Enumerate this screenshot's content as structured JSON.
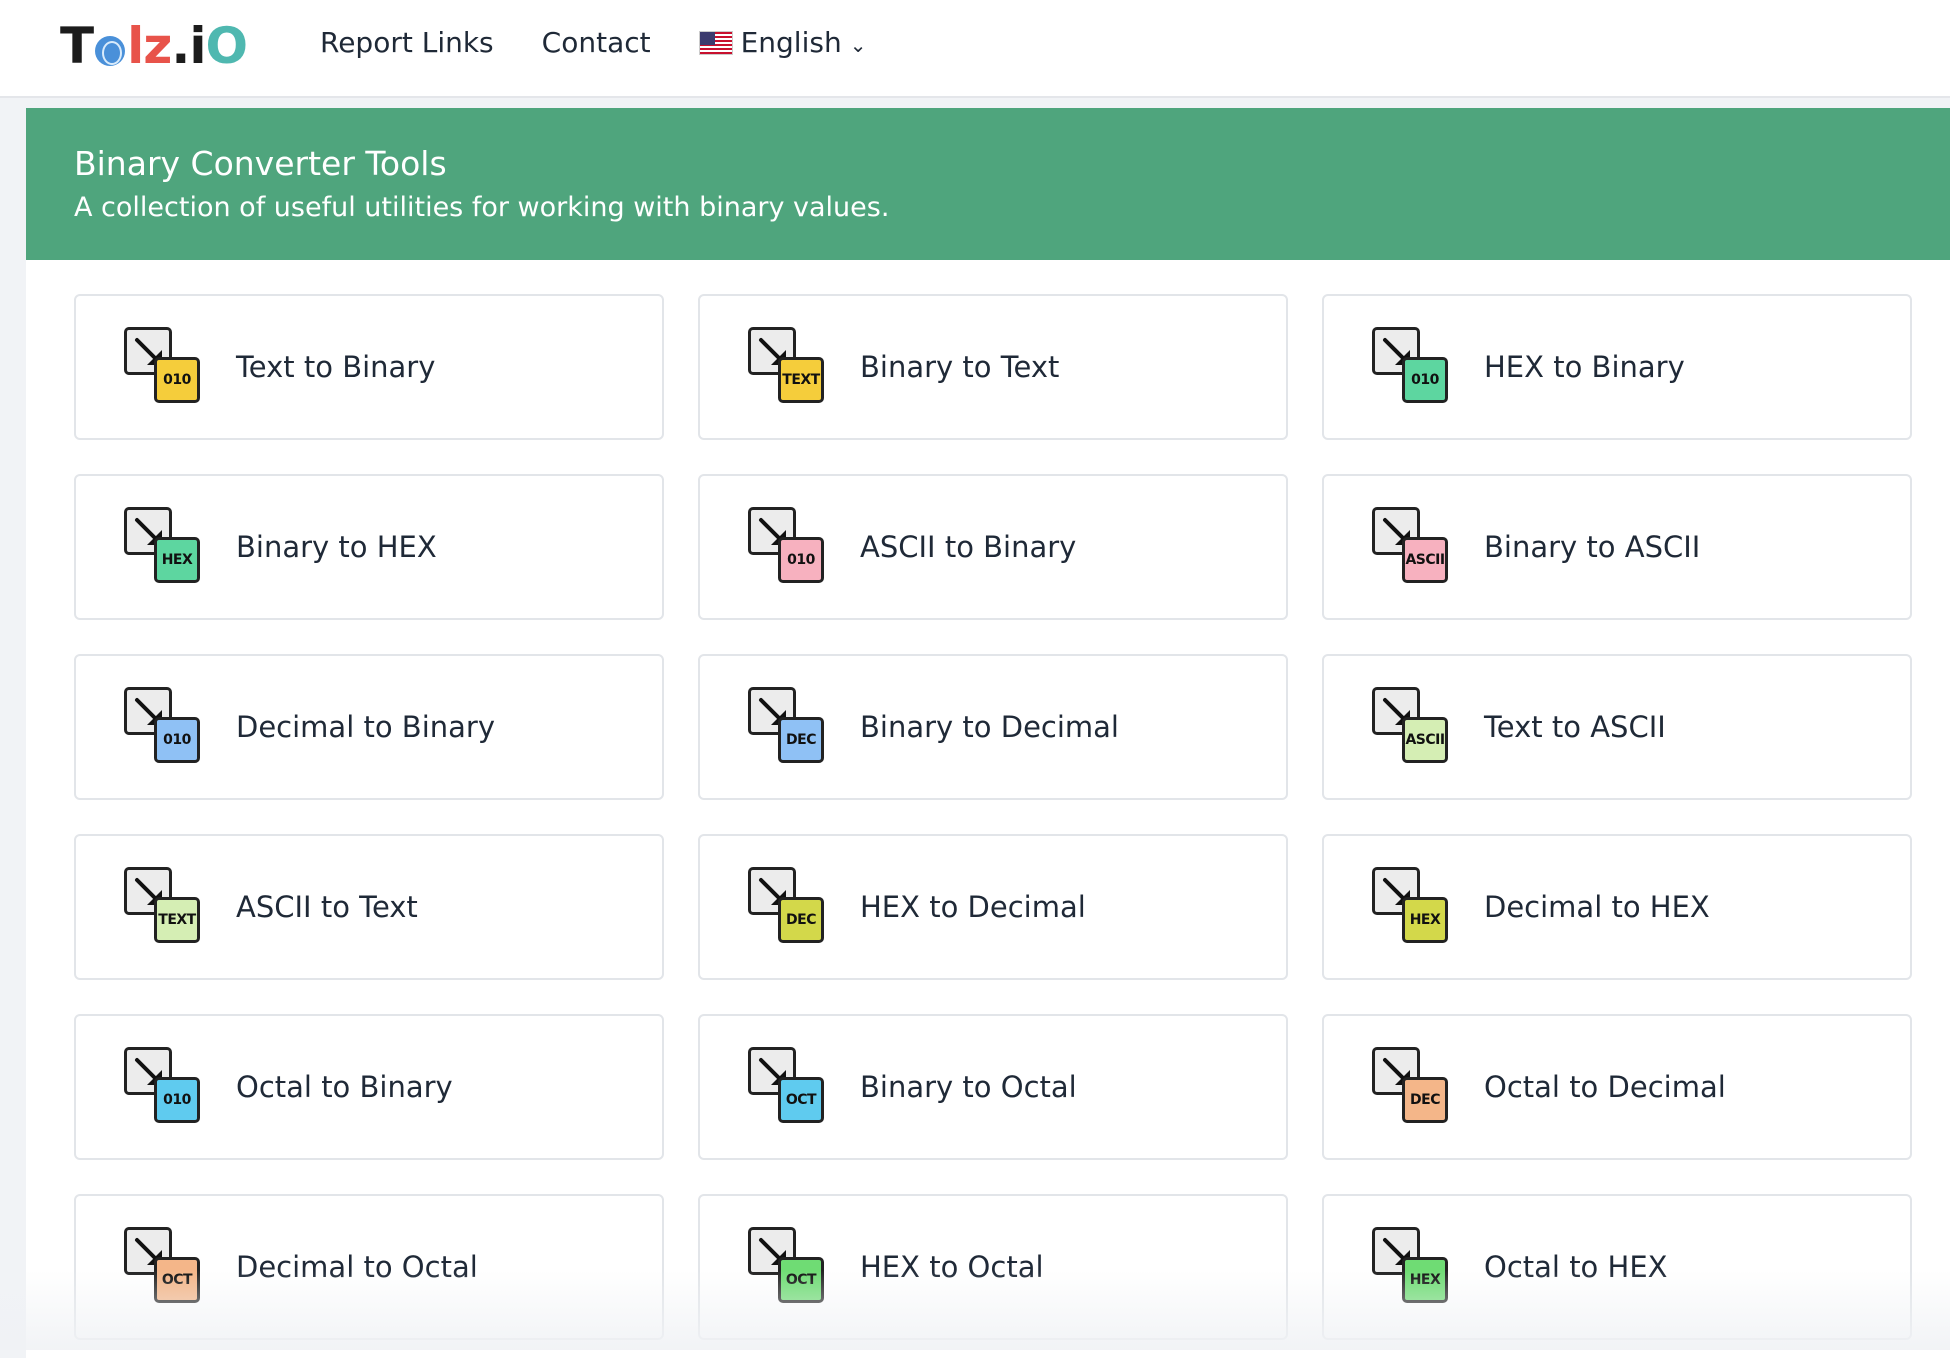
{
  "nav": {
    "logo": {
      "part1": "T",
      "part2": "lz",
      "part3": ".i",
      "part4": "O"
    },
    "links": [
      "Report Links",
      "Contact"
    ],
    "language": "English",
    "colors": {
      "logo_dark": "#1c1c1c",
      "logo_red": "#e8534a",
      "logo_teal": "#4fb8b0"
    }
  },
  "banner": {
    "title": "Binary Converter Tools",
    "subtitle": "A collection of useful utilities for working with binary values.",
    "color": "#4fa57d"
  },
  "tools": [
    {
      "label": "Text to Binary",
      "badge": "010",
      "color": "#f5cd3b"
    },
    {
      "label": "Binary to Text",
      "badge": "TEXT",
      "color": "#f5cd3b"
    },
    {
      "label": "HEX to Binary",
      "badge": "010",
      "color": "#5dd6a0"
    },
    {
      "label": "Binary to HEX",
      "badge": "HEX",
      "color": "#5dd6a0"
    },
    {
      "label": "ASCII to Binary",
      "badge": "010",
      "color": "#f7b1bf"
    },
    {
      "label": "Binary to ASCII",
      "badge": "ASCII",
      "color": "#f7b1bf"
    },
    {
      "label": "Decimal to Binary",
      "badge": "010",
      "color": "#8fc1f5"
    },
    {
      "label": "Binary to Decimal",
      "badge": "DEC",
      "color": "#8fc1f5"
    },
    {
      "label": "Text to ASCII",
      "badge": "ASCII",
      "color": "#d5eeb4"
    },
    {
      "label": "ASCII to Text",
      "badge": "TEXT",
      "color": "#d5eeb4"
    },
    {
      "label": "HEX to Decimal",
      "badge": "DEC",
      "color": "#d3d84a"
    },
    {
      "label": "Decimal to HEX",
      "badge": "HEX",
      "color": "#d3d84a"
    },
    {
      "label": "Octal to Binary",
      "badge": "010",
      "color": "#5fcbef"
    },
    {
      "label": "Binary to Octal",
      "badge": "OCT",
      "color": "#5fcbef"
    },
    {
      "label": "Octal to Decimal",
      "badge": "DEC",
      "color": "#f4b689"
    },
    {
      "label": "Decimal to Octal",
      "badge": "OCT",
      "color": "#f4b689"
    },
    {
      "label": "HEX to Octal",
      "badge": "OCT",
      "color": "#6fdc74"
    },
    {
      "label": "Octal to HEX",
      "badge": "HEX",
      "color": "#6fdc74"
    }
  ]
}
